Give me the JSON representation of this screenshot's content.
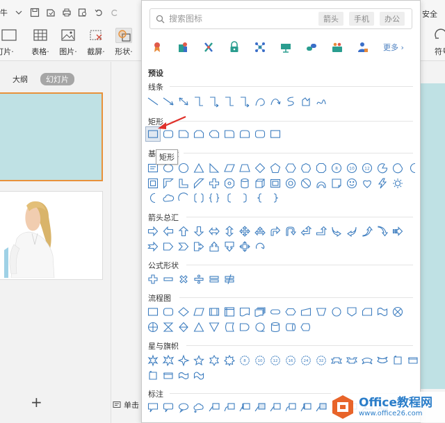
{
  "ribbon": {
    "qa_text": "牛",
    "tools": [
      {
        "label": "灯片·",
        "icon": "slide-icon"
      },
      {
        "label": "表格·",
        "icon": "table-icon"
      },
      {
        "label": "图片·",
        "icon": "picture-icon"
      },
      {
        "label": "截屏·",
        "icon": "screenshot-icon"
      },
      {
        "label": "形状·",
        "icon": "shapes-icon"
      }
    ]
  },
  "right_ribbon": {
    "top_label": "安全",
    "tool_label": "符号"
  },
  "left_panel": {
    "tab_outline": "大纲",
    "tab_slides": "幻灯片",
    "add_label": "+"
  },
  "status": {
    "note_label": "单击"
  },
  "shape_panel": {
    "search_placeholder": "搜索图标",
    "tags": [
      "箭头",
      "手机",
      "办公"
    ],
    "more_label": "更多 ›",
    "preset_title": "预设",
    "sections": {
      "lines": "线条",
      "rect": "矩形",
      "basic": "基本形状",
      "arrows": "箭头总汇",
      "formula": "公式形状",
      "flow": "流程图",
      "stars": "星与旗帜",
      "callouts": "标注"
    },
    "tooltip": "矩形"
  },
  "logo": {
    "main": "Office教程网",
    "sub": "www.office26.com"
  },
  "colors": {
    "accent": "#e8913a",
    "shape_stroke": "#3d7dbf",
    "slide_bg": "#bfe1e4"
  }
}
